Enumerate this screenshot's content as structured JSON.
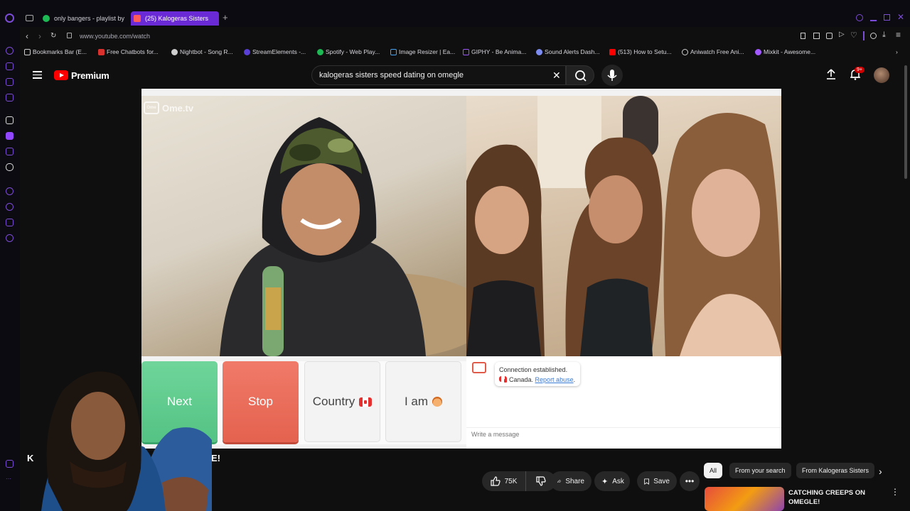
{
  "browser": {
    "tabs": [
      {
        "label": "only bangers - playlist by",
        "active": false,
        "icon": "spotify-icon",
        "color": "#1db954"
      },
      {
        "label": "(25) Kalogeras Sisters",
        "active": true,
        "icon": "speaker-icon",
        "color": "#ff0000"
      }
    ],
    "url": "www.youtube.com/watch",
    "bookmarks": [
      {
        "label": "Bookmarks Bar (E...",
        "icon": "folder-icon",
        "color": "#cfcfcf"
      },
      {
        "label": "Free Chatbots for...",
        "icon": "red-square-icon",
        "color": "#d9322e"
      },
      {
        "label": "Nightbot - Song R...",
        "icon": "nightbot-icon",
        "color": "#cfcfcf"
      },
      {
        "label": "StreamElements -...",
        "icon": "streamelements-icon",
        "color": "#5a3fd6"
      },
      {
        "label": "Spotify - Web Play...",
        "icon": "spotify-icon",
        "color": "#1db954"
      },
      {
        "label": "Image Resizer | Ea...",
        "icon": "image-icon",
        "color": "#4aa3f0"
      },
      {
        "label": "GIPHY - Be Anima...",
        "icon": "giphy-icon",
        "color": "#9b59f6"
      },
      {
        "label": "Sound Alerts Dash...",
        "icon": "sound-alerts-icon",
        "color": "#7d8cf0"
      },
      {
        "label": "(513) How to Setu...",
        "icon": "youtube-icon",
        "color": "#ff0000"
      },
      {
        "label": "Aniwatch Free Ani...",
        "icon": "aniwatch-icon",
        "color": "#cfcfcf"
      },
      {
        "label": "Mixkit - Awesome...",
        "icon": "mixkit-icon",
        "color": "#a259ff"
      }
    ]
  },
  "youtube": {
    "brand": "Premium",
    "search": {
      "value": "kalogeras sisters speed dating on omegle",
      "placeholder": "Search"
    },
    "notification_badge": "9+",
    "video": {
      "overlay_logo": "Ome.tv",
      "buttons": {
        "next": "Next",
        "stop": "Stop",
        "country": "Country",
        "iam": "I am"
      },
      "chat": {
        "status": "Connection established.",
        "country": "Canada.",
        "report": "Report abuse",
        "input_placeholder": "Write a message"
      }
    },
    "title_visible_start": "K",
    "title_visible_end": "MEGLE!",
    "actions": {
      "likes": "75K",
      "share": "Share",
      "ask": "Ask",
      "save": "Save"
    },
    "chips": [
      "All",
      "From your search",
      "From Kalogeras Sisters"
    ],
    "recommendation": {
      "title": "CATCHING CREEPS ON OMEGLE!"
    }
  },
  "colors": {
    "accent": "#6a2bd6",
    "brand_red": "#ff0000",
    "next_green": "#54c384",
    "stop_red": "#e4624f"
  }
}
